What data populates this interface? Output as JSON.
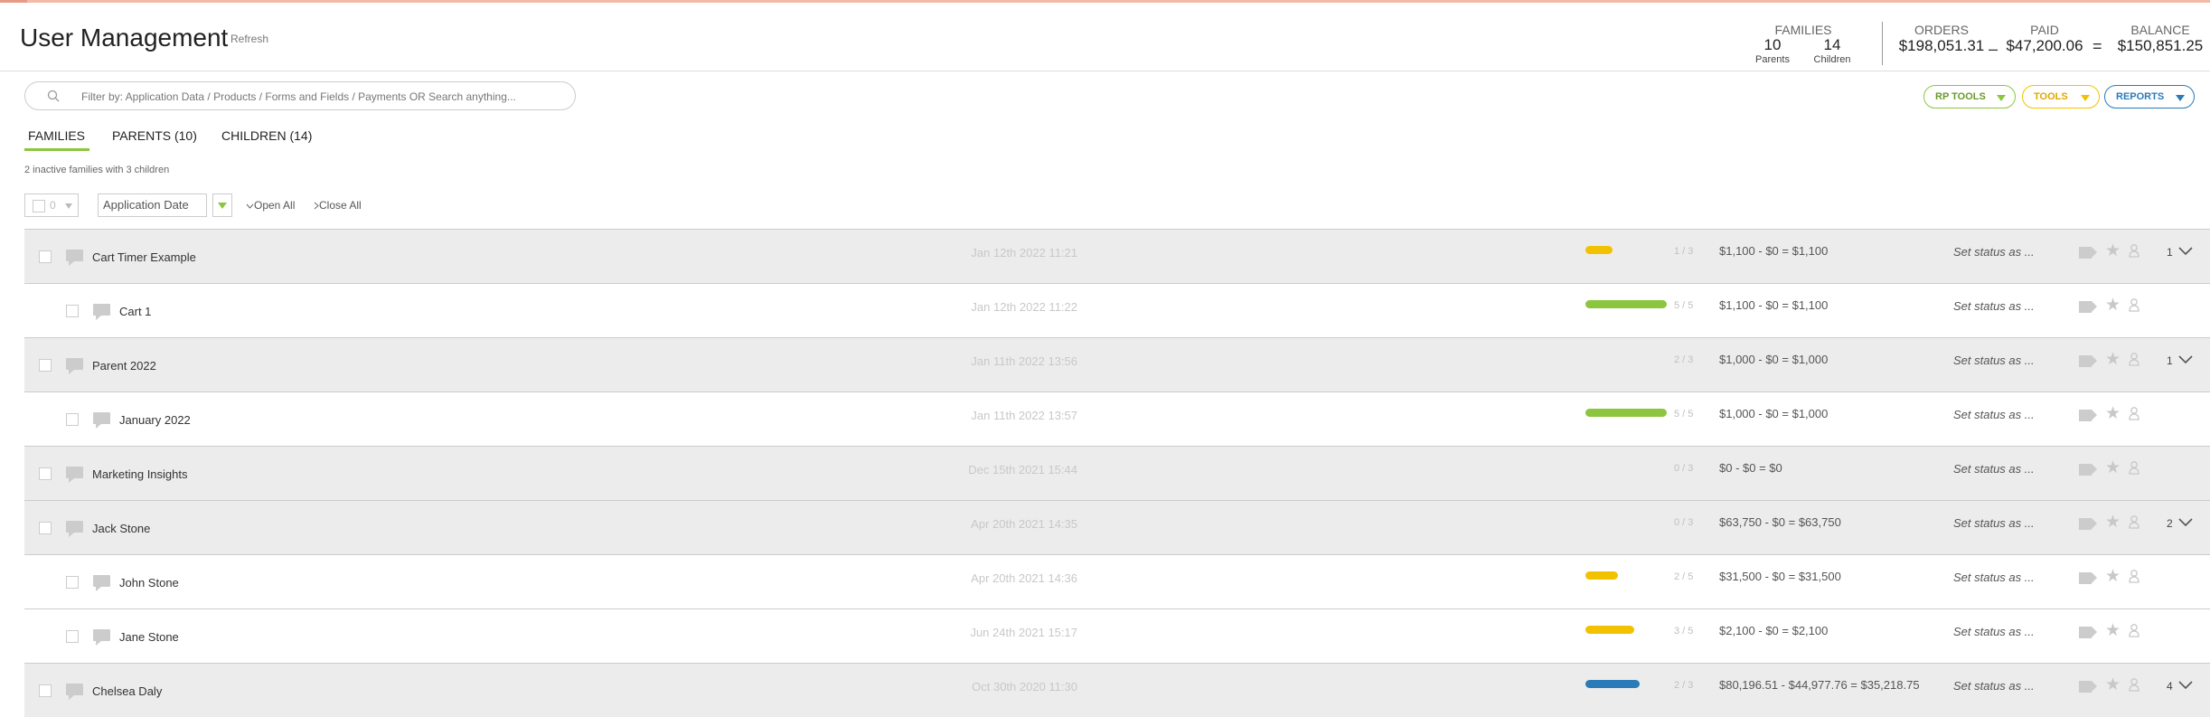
{
  "header": {
    "title": "User Management",
    "refresh": "Refresh",
    "families_label": "FAMILIES",
    "parents_count": "10",
    "parents_label": "Parents",
    "children_count": "14",
    "children_label": "Children",
    "orders_label": "ORDERS",
    "orders_value": "$198,051.31",
    "minus": "–",
    "paid_label": "PAID",
    "paid_value": "$47,200.06",
    "equals": "=",
    "balance_label": "BALANCE",
    "balance_value": "$150,851.25"
  },
  "search": {
    "placeholder": "Filter by: Application Data / Products / Forms and Fields / Payments OR Search anything..."
  },
  "toolbar": {
    "rp_tools": "RP TOOLS",
    "tools": "TOOLS",
    "reports": "REPORTS"
  },
  "tabs": [
    {
      "label": "FAMILIES",
      "active": true
    },
    {
      "label": "PARENTS (10)"
    },
    {
      "label": "CHILDREN (14)"
    }
  ],
  "inactive_note": "2 inactive families with 3 children",
  "controls": {
    "selected_count": "0",
    "sort_field": "Application Date",
    "open_all": "Open All",
    "close_all": "Close All"
  },
  "colors": {
    "green": "#8cc63f",
    "yellow": "#f2c200",
    "blue": "#2b7bb9",
    "tools_yellow": "#f2c200",
    "reports_blue": "#2b7bb9"
  },
  "rows": [
    {
      "type": "parent",
      "name": "Cart Timer Example",
      "date": "Jan 12th 2022 11:21",
      "progress": 0.33,
      "bar_color": "yellow",
      "count": "1 / 3",
      "money": "$1,100  -  $0  =  $1,100",
      "status": "Set status as ...",
      "kids": "1"
    },
    {
      "type": "child",
      "name": "Cart 1",
      "date": "Jan 12th 2022 11:22",
      "progress": 1.0,
      "bar_color": "green",
      "count": "5 / 5",
      "money": "$1,100  -  $0  =  $1,100",
      "status": "Set status as ..."
    },
    {
      "type": "parent",
      "name": "Parent 2022",
      "date": "Jan 11th 2022 13:56",
      "progress": 0,
      "bar_color": "",
      "count": "2 / 3",
      "money": "$1,000  -  $0  =  $1,000",
      "status": "Set status as ...",
      "kids": "1"
    },
    {
      "type": "child",
      "name": "January 2022",
      "date": "Jan 11th 2022 13:57",
      "progress": 1.0,
      "bar_color": "green",
      "count": "5 / 5",
      "money": "$1,000  -  $0  =  $1,000",
      "status": "Set status as ..."
    },
    {
      "type": "parent",
      "name": "Marketing Insights",
      "date": "Dec 15th 2021 15:44",
      "progress": 0,
      "bar_color": "",
      "count": "0 / 3",
      "money": "$0  -  $0  =  $0",
      "status": "Set status as ..."
    },
    {
      "type": "parent",
      "name": "Jack Stone",
      "date": "Apr 20th 2021 14:35",
      "progress": 0,
      "bar_color": "",
      "count": "0 / 3",
      "money": "$63,750  -  $0  =  $63,750",
      "status": "Set status as ...",
      "kids": "2"
    },
    {
      "type": "child",
      "name": "John Stone",
      "date": "Apr 20th 2021 14:36",
      "progress": 0.4,
      "bar_color": "yellow",
      "count": "2 / 5",
      "money": "$31,500  -  $0  =  $31,500",
      "status": "Set status as ..."
    },
    {
      "type": "child",
      "name": "Jane Stone",
      "date": "Jun 24th 2021 15:17",
      "progress": 0.6,
      "bar_color": "yellow",
      "count": "3 / 5",
      "money": "$2,100  -  $0  =  $2,100",
      "status": "Set status as ..."
    },
    {
      "type": "parent",
      "name": "Chelsea Daly",
      "date": "Oct 30th 2020 11:30",
      "progress": 0.67,
      "bar_color": "blue",
      "count": "2 / 3",
      "money": "$80,196.51  -  $44,977.76  =  $35,218.75",
      "status": "Set status as ...",
      "kids": "4"
    }
  ]
}
